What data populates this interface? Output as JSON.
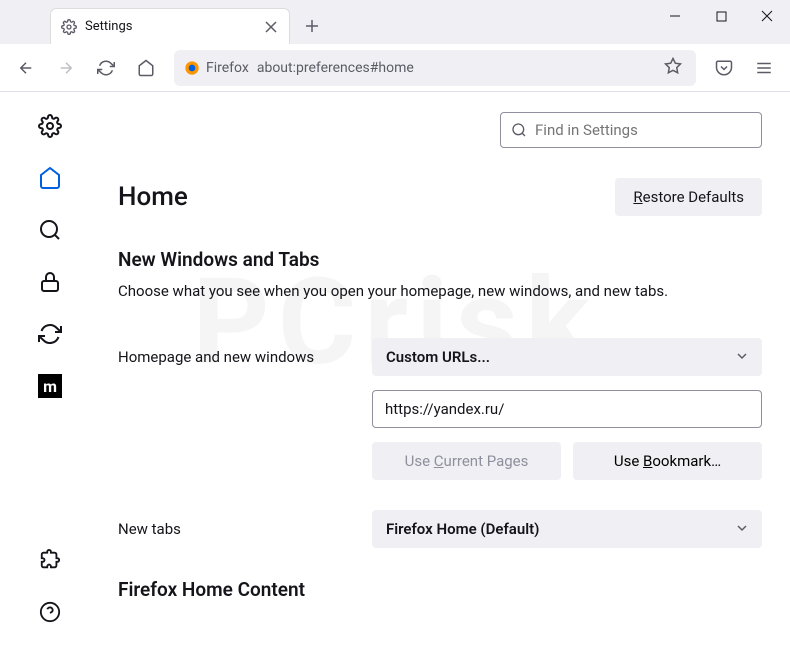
{
  "window": {
    "tab_title": "Settings",
    "new_tab_glyph": "+",
    "close_glyph": "×"
  },
  "toolbar": {
    "identity_label": "Firefox",
    "url": "about:preferences#home"
  },
  "search": {
    "placeholder": "Find in Settings"
  },
  "page": {
    "title": "Home",
    "restore_label": "Restore Defaults"
  },
  "section": {
    "title": "New Windows and Tabs",
    "desc": "Choose what you see when you open your homepage, new windows, and new tabs."
  },
  "homepage": {
    "label": "Homepage and new windows",
    "select_value": "Custom URLs...",
    "url_value": "https://yandex.ru/",
    "use_current": "Use Current Pages",
    "use_bookmark": "Use Bookmark…"
  },
  "newtabs": {
    "label": "New tabs",
    "select_value": "Firefox Home (Default)"
  },
  "subsection": {
    "title": "Firefox Home Content"
  },
  "sidebar": {
    "m_label": "m"
  }
}
